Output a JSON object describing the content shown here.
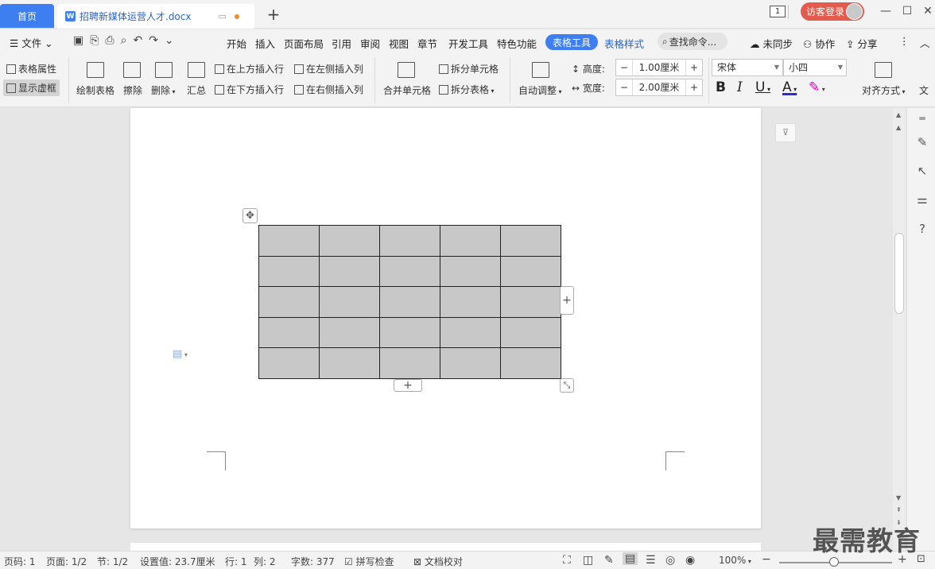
{
  "titlebar": {
    "home_tab": "首页",
    "doc_tab_icon": "W",
    "doc_tab_title": "招聘新媒体运营人才.docx",
    "page_badge": "1",
    "login_label": "访客登录",
    "new_tab": "+"
  },
  "menubar": {
    "file_label": "文件",
    "tabs": [
      "开始",
      "插入",
      "页面布局",
      "引用",
      "审阅",
      "视图",
      "章节",
      "开发工具",
      "特色功能"
    ],
    "active_tab": "表格工具",
    "table_style_tab": "表格样式",
    "search_label": "查找命令...",
    "sync_label": "未同步",
    "collab_label": "协作",
    "share_label": "分享"
  },
  "ribbon": {
    "table_props": "表格属性",
    "show_gridlines": "显示虚框",
    "draw_table": "绘制表格",
    "erase": "擦除",
    "delete": "删除",
    "summary": "汇总",
    "insert_above": "在上方插入行",
    "insert_below": "在下方插入行",
    "insert_left": "在左侧插入列",
    "insert_right": "在右侧插入列",
    "merge_cells": "合并单元格",
    "split_cells": "拆分单元格",
    "split_table": "拆分表格",
    "auto_fit": "自动调整",
    "height_label": "高度:",
    "height_value": "1.00厘米",
    "width_label": "宽度:",
    "width_value": "2.00厘米",
    "font_name": "宋体",
    "font_size": "小四",
    "align_label": "对齐方式",
    "text_dir": "文"
  },
  "table": {
    "rows": 5,
    "cols": 5,
    "fill": "#c8c8c8"
  },
  "statusbar": {
    "page_num": "页码: 1",
    "pages": "页面: 1/2",
    "section": "节: 1/2",
    "position": "设置值: 23.7厘米",
    "row": "行: 1",
    "col": "列: 2",
    "word_count": "字数: 377",
    "spell_check": "拼写检查",
    "doc_check": "文档校对",
    "zoom": "100%"
  },
  "watermark": "最需教育",
  "colors": {
    "accent": "#3d7ef0",
    "login": "#e45a4c",
    "font_color": "#2a2ad0",
    "highlight": "#e000c0"
  }
}
